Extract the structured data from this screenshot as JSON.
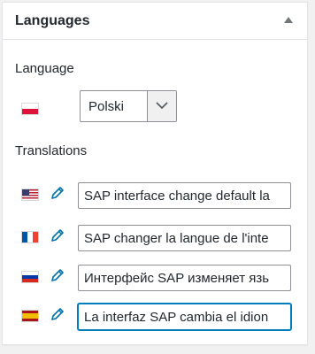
{
  "panel": {
    "title": "Languages",
    "toggle_icon": "caret-up-icon"
  },
  "language": {
    "label": "Language",
    "flag": "flag-poland-icon",
    "selected": "Polski"
  },
  "translations": {
    "label": "Translations",
    "items": [
      {
        "flag": "flag-usa-icon",
        "value": "SAP interface change default la"
      },
      {
        "flag": "flag-france-icon",
        "value": "SAP changer la langue de l'inte"
      },
      {
        "flag": "flag-russia-icon",
        "value": "Интерфейс SAP изменяет язь"
      },
      {
        "flag": "flag-spain-icon",
        "value": "La interfaz SAP cambia el idion"
      }
    ]
  },
  "colors": {
    "accent": "#007cba",
    "pencil": "#0073aa"
  }
}
